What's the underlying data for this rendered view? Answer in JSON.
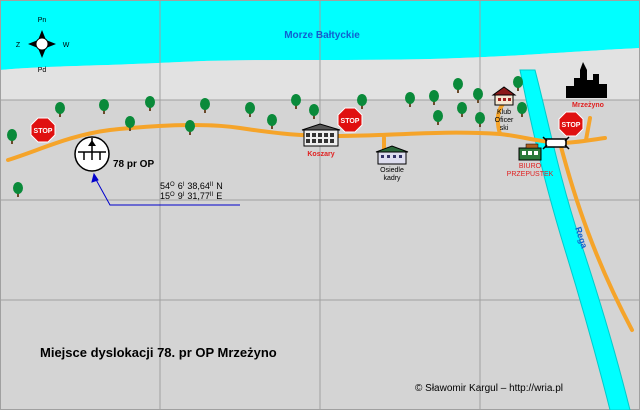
{
  "compass": {
    "north": "Pn",
    "south": "Pd",
    "east": "W",
    "west": "Z"
  },
  "sea_label": "Morze Bałtyckie",
  "unit_label": "78 pr OP",
  "coordinates": {
    "lat_deg": "54",
    "lat_min": "6",
    "lat_sec": "38,64",
    "lat_hem": "N",
    "lon_deg": "15",
    "lon_min": "9",
    "lon_sec": "31,77",
    "lon_hem": "E",
    "deg_mark": "O",
    "min_mark": "I",
    "sec_mark": "II"
  },
  "places": {
    "koszary": "Koszary",
    "osiedle_line1": "Osiedle",
    "osiedle_line2": "kadry",
    "klub_line1": "Klub",
    "klub_line2": "Oficer",
    "klub_line3": "ski",
    "biuro_line1": "BIURO",
    "biuro_line2": "PRZEPUSTEK",
    "town": "Mrzeżyno",
    "river": "Rega"
  },
  "stop_sign_text": "STOP",
  "caption": "Miejsce dyslokacji 78. pr OP Mrzeżyno",
  "credit": "© Sławomir Kargul – http://wria.pl",
  "colors": {
    "sea": "#00ffff",
    "land": "#d4d4d4",
    "road": "#f5a42a",
    "river": "#00ffff",
    "tree": "#0a8a3a",
    "stop": "#e01010",
    "label_red": "#e02020",
    "sea_label": "#1060d0",
    "pointer": "#0000cc"
  }
}
